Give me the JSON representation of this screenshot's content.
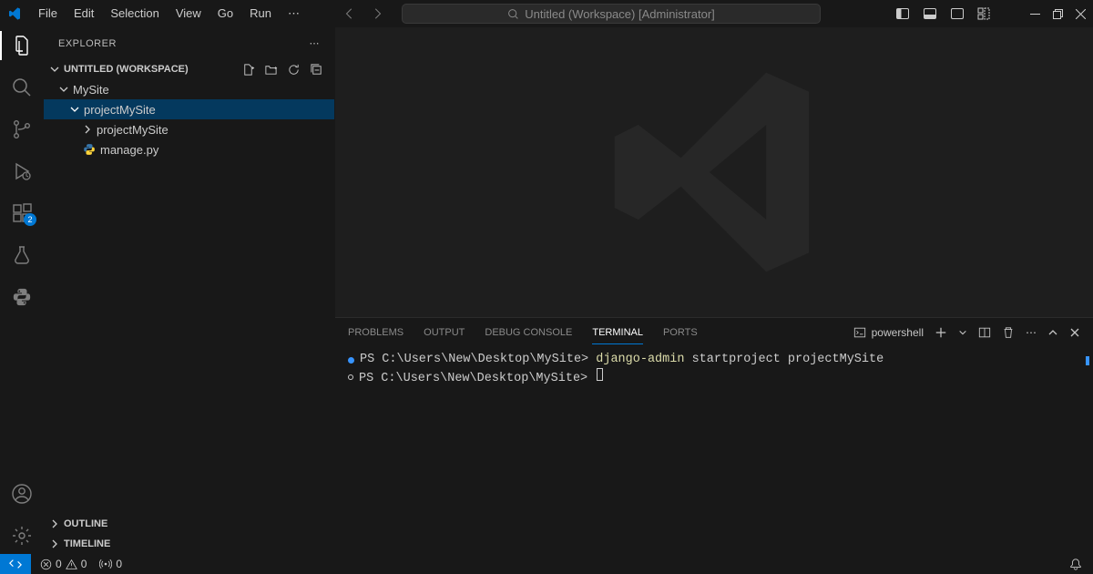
{
  "titlebar": {
    "menu": [
      "File",
      "Edit",
      "Selection",
      "View",
      "Go",
      "Run",
      "⋯"
    ],
    "search_label": "Untitled (Workspace) [Administrator]"
  },
  "activitybar": {
    "extensions_badge": "2"
  },
  "sidebar": {
    "title": "EXPLORER",
    "workspace_label": "UNTITLED (WORKSPACE)",
    "tree": {
      "root": "MySite",
      "folder": "projectMySite",
      "subfolder": "projectMySite",
      "file": "manage.py"
    },
    "sections": {
      "outline": "OUTLINE",
      "timeline": "TIMELINE"
    }
  },
  "panel": {
    "tabs": {
      "problems": "PROBLEMS",
      "output": "OUTPUT",
      "debug": "DEBUG CONSOLE",
      "terminal": "TERMINAL",
      "ports": "PORTS"
    },
    "shell_label": "powershell"
  },
  "terminal": {
    "line1_prompt": "PS C:\\Users\\New\\Desktop\\MySite> ",
    "line1_cmd_a": "django-admin",
    "line1_cmd_b": " startproject projectMySite",
    "line2_prompt": "PS C:\\Users\\New\\Desktop\\MySite> "
  },
  "statusbar": {
    "errors": "0",
    "warnings": "0",
    "ports": "0"
  }
}
